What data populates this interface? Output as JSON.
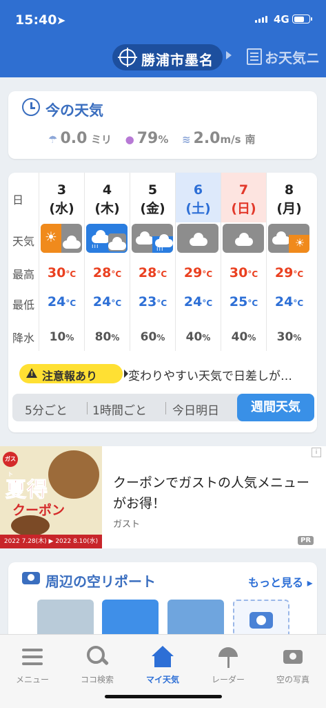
{
  "status_bar": {
    "time": "15:40",
    "network": "4G"
  },
  "header": {
    "location": "勝浦市墨名",
    "next_tab": "お天気ニ"
  },
  "now": {
    "title": "今の天気",
    "rain_value": "0.0",
    "rain_unit": "ミリ",
    "humidity_value": "79",
    "humidity_unit": "%",
    "wind_value": "2.0",
    "wind_unit": "m/s",
    "wind_dir": "南"
  },
  "weekly": {
    "row_labels": {
      "day": "日",
      "weather": "天気",
      "max": "最高",
      "min": "最低",
      "precip": "降水"
    },
    "temp_unit": "°C",
    "precip_unit": "%",
    "days": [
      {
        "date": "3",
        "weekday": "(水)",
        "kind": "weekday",
        "weather": "sunny-then-cloudy",
        "max": "30",
        "min": "24",
        "precip": "10"
      },
      {
        "date": "4",
        "weekday": "(木)",
        "kind": "weekday",
        "weather": "rain-then-cloudy",
        "max": "28",
        "min": "24",
        "precip": "80"
      },
      {
        "date": "5",
        "weekday": "(金)",
        "kind": "weekday",
        "weather": "cloudy-then-rain",
        "max": "28",
        "min": "23",
        "precip": "60"
      },
      {
        "date": "6",
        "weekday": "(土)",
        "kind": "saturday",
        "weather": "cloudy",
        "max": "29",
        "min": "24",
        "precip": "40"
      },
      {
        "date": "7",
        "weekday": "(日)",
        "kind": "sunday",
        "weather": "cloudy",
        "max": "30",
        "min": "25",
        "precip": "40"
      },
      {
        "date": "8",
        "weekday": "(月)",
        "kind": "weekday",
        "weather": "cloudy-then-sunny",
        "max": "29",
        "min": "24",
        "precip": "30"
      }
    ],
    "alert_badge": "注意報あり",
    "alert_text": "変わりやすい天気で日差しが…",
    "segments": [
      "5分ごと",
      "1時間ごと",
      "今日明日",
      "週間天気"
    ],
    "active_segment": "週間天気"
  },
  "ad": {
    "image_logo": "ガスト",
    "image_big": "夏得",
    "image_mid": "クーポン",
    "image_band": "2022 7.28(木) ▶ 2022 8.10(水)",
    "title": "クーポンでガストの人気メニューがお得！",
    "brand": "ガスト",
    "pr": "PR",
    "info": "i"
  },
  "report": {
    "title": "周辺の空リポート",
    "more": "もっと見る"
  },
  "tabbar": {
    "items": [
      {
        "label": "メニュー",
        "icon": "menu-icon"
      },
      {
        "label": "ココ検索",
        "icon": "search-icon"
      },
      {
        "label": "マイ天気",
        "icon": "home-icon"
      },
      {
        "label": "レーダー",
        "icon": "umbrella-icon"
      },
      {
        "label": "空の写真",
        "icon": "camera-icon"
      }
    ],
    "active": "マイ天気"
  },
  "colors": {
    "header_blue": "#2f6fd1",
    "accent_blue": "#3990e7",
    "max_red": "#ea4020",
    "min_blue": "#2d6fd6",
    "alert_yellow": "#ffe033"
  }
}
